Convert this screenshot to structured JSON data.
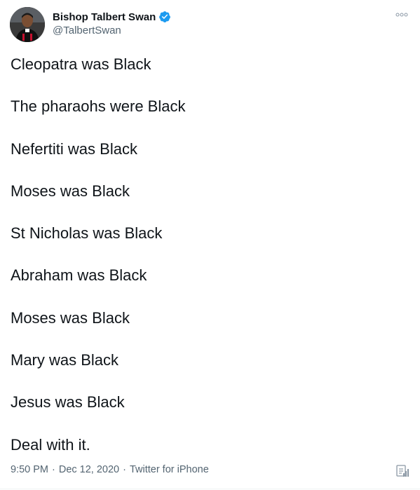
{
  "author": {
    "name": "Bishop Talbert Swan",
    "handle": "@TalbertSwan",
    "verified": true,
    "verified_color": "#1d9bf0",
    "avatar_icon": "profile-photo"
  },
  "menu_icon": "more-options-icon",
  "tweet_lines": [
    "Cleopatra was Black",
    "The pharaohs were Black",
    "Nefertiti was Black",
    "Moses was Black",
    "St Nicholas was Black",
    "Abraham was Black",
    "Moses was Black",
    "Mary was Black",
    "Jesus was Black",
    "Deal with it."
  ],
  "meta": {
    "time": "9:50 PM",
    "separator": "·",
    "date": "Dec 12, 2020",
    "source": "Twitter for iPhone"
  },
  "analytics_icon": "analytics-icon",
  "colors": {
    "text": "#0f1419",
    "secondary": "#536471",
    "border": "#eff3f4"
  }
}
